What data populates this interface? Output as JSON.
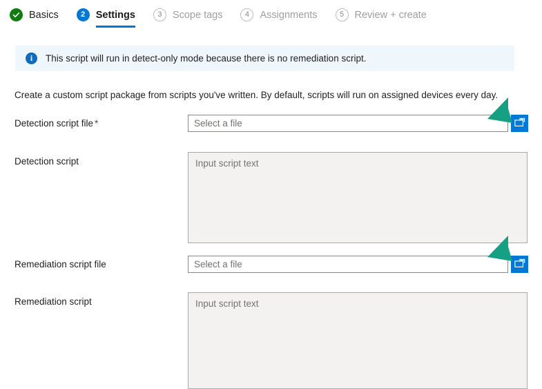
{
  "wizard": {
    "steps": [
      {
        "number": "✓",
        "label": "Basics",
        "state": "done"
      },
      {
        "number": "2",
        "label": "Settings",
        "state": "current"
      },
      {
        "number": "3",
        "label": "Scope tags",
        "state": "pending"
      },
      {
        "number": "4",
        "label": "Assignments",
        "state": "pending"
      },
      {
        "number": "5",
        "label": "Review + create",
        "state": "pending"
      }
    ]
  },
  "banner": {
    "icon": "info-icon",
    "glyph": "i",
    "text": "This script will run in detect-only mode because there is no remediation script.",
    "background_color": "#eff6fc",
    "icon_color": "#0f6cbd"
  },
  "form": {
    "description": "Create a custom script package from scripts you've written. By default, scripts will run on assigned devices every day.",
    "detection_script_file": {
      "label": "Detection script file",
      "required_marker": "*",
      "value": "",
      "placeholder": "Select a file",
      "browse_icon": "folder-open-icon"
    },
    "detection_script": {
      "label": "Detection script",
      "value": "",
      "placeholder": "Input script text"
    },
    "remediation_script_file": {
      "label": "Remediation script file",
      "value": "",
      "placeholder": "Select a file",
      "browse_icon": "folder-open-icon"
    },
    "remediation_script": {
      "label": "Remediation script",
      "value": "",
      "placeholder": "Input script text"
    }
  },
  "annotations": {
    "arrow_color": "#15a084",
    "arrows": [
      {
        "name": "arrow-pointing-to-detection-browse",
        "direction": "down-left"
      },
      {
        "name": "arrow-pointing-to-remediation-browse",
        "direction": "down-left"
      }
    ]
  },
  "colors": {
    "accent": "#0078d4",
    "success": "#107c10",
    "required": "#a4262c",
    "field_fill": "#f3f2f1"
  }
}
